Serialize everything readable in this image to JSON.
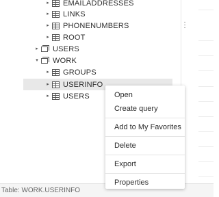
{
  "tree": {
    "items": [
      {
        "label": "EMAILADDRESSES",
        "type": "table",
        "expander": "▸"
      },
      {
        "label": "LINKS",
        "type": "table",
        "expander": "▸"
      },
      {
        "label": "PHONENUMBERS",
        "type": "table",
        "expander": "▸"
      },
      {
        "label": "ROOT",
        "type": "table",
        "expander": "▸"
      },
      {
        "label": "USERS",
        "type": "library",
        "expander": "▸"
      },
      {
        "label": "WORK",
        "type": "library",
        "expander": "▾"
      },
      {
        "label": "GROUPS",
        "type": "table",
        "expander": "▸"
      },
      {
        "label": "USERINFO",
        "type": "table",
        "expander": "▸",
        "selected": true
      },
      {
        "label": "USERS",
        "type": "table",
        "expander": "▸"
      }
    ]
  },
  "context_menu": {
    "open": "Open",
    "create_query": "Create query",
    "add_favorites": "Add to My Favorites",
    "delete": "Delete",
    "export": "Export",
    "properties": "Properties"
  },
  "status_bar": {
    "text": "Table: WORK.USERINFO"
  },
  "icons": {
    "expand": "expand-caret-icon",
    "collapse": "collapse-caret-icon",
    "table": "table-icon",
    "library": "library-icon",
    "splitter": "vertical-ellipsis-icon"
  }
}
